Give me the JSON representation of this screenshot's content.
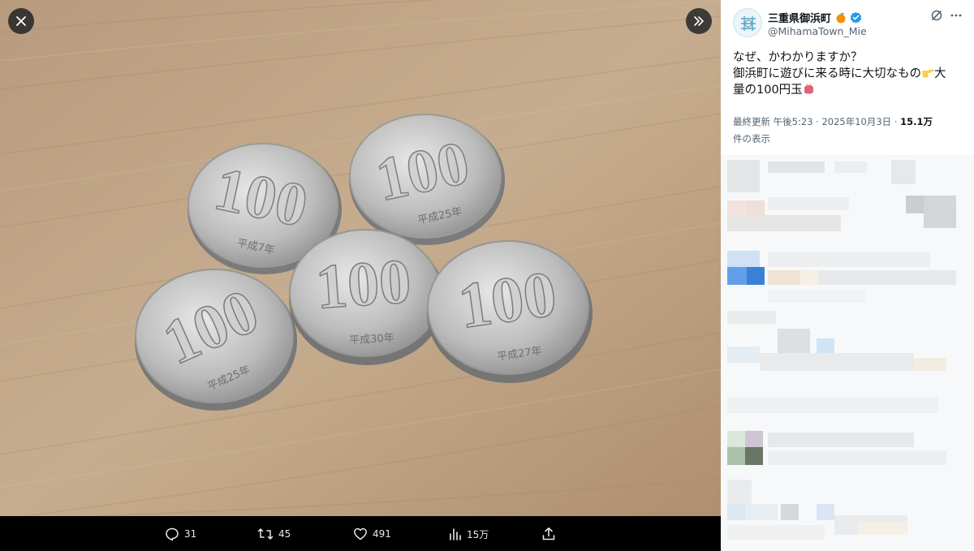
{
  "account": {
    "display_name": "三重県御浜町",
    "handle": "@MihamaTown_Mie",
    "verified": true,
    "badge_color": "#1d9bf0"
  },
  "tweet": {
    "line1": "なぜ、かわかりますか？",
    "line2": "御浜町に遊びに来る時に大切なもの",
    "line2_tail": "大",
    "line3": "量の100円玉",
    "updated_label": "最終更新",
    "time": "午後5:23",
    "dot": "·",
    "date": "2025年10月3日",
    "view_count": "15.1万",
    "views_label": "件の表示"
  },
  "actions": {
    "replies": "31",
    "reposts": "45",
    "likes": "491",
    "views": "15万"
  },
  "photo": {
    "coins": [
      {
        "face": "100",
        "era": "平成7年"
      },
      {
        "face": "100",
        "era": "平成25年"
      },
      {
        "face": "100",
        "era": "平成30年"
      },
      {
        "face": "100",
        "era": "平成27年"
      },
      {
        "face": "100",
        "era": "平成25年"
      }
    ]
  },
  "icons": [
    "close-icon",
    "expand-icon",
    "grok-icon",
    "more-icon",
    "reply-icon",
    "repost-icon",
    "like-icon",
    "views-icon",
    "share-icon",
    "verified-badge-icon"
  ],
  "colors": {
    "action_text": "#e7e9ea",
    "secondary_text": "#536471",
    "primary_text": "#0f1419"
  }
}
